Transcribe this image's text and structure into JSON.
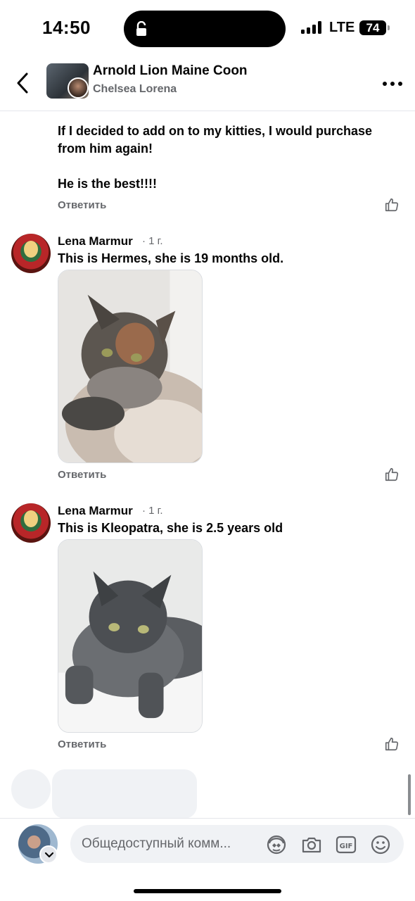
{
  "status_bar": {
    "time": "14:50",
    "network": "LTE",
    "battery": "74"
  },
  "header": {
    "title": "Arnold Lion Maine Coon",
    "subtitle": "Chelsea Lorena"
  },
  "comments": [
    {
      "text": "If I decided to add on to my kitties, I would purchase from him again!\n\nHe is the best!!!!",
      "reply": "Ответить"
    },
    {
      "author": "Lena Marmur",
      "time": "· 1 г.",
      "text": "This is Hermes, she is 19 months old.",
      "reply": "Ответить"
    },
    {
      "author": "Lena Marmur",
      "time": "· 1 г.",
      "text": "This is Kleopatra, she is 2.5 years old",
      "reply": "Ответить"
    }
  ],
  "composer": {
    "placeholder": "Общедоступный комм..."
  },
  "icons": {
    "back": "chevron-left-icon",
    "more": "more-horizontal-icon",
    "like": "thumbs-up-icon",
    "avatar_sticker": "avatar-sticker-icon",
    "camera": "camera-icon",
    "gif": "gif-icon",
    "emoji": "emoji-icon"
  }
}
